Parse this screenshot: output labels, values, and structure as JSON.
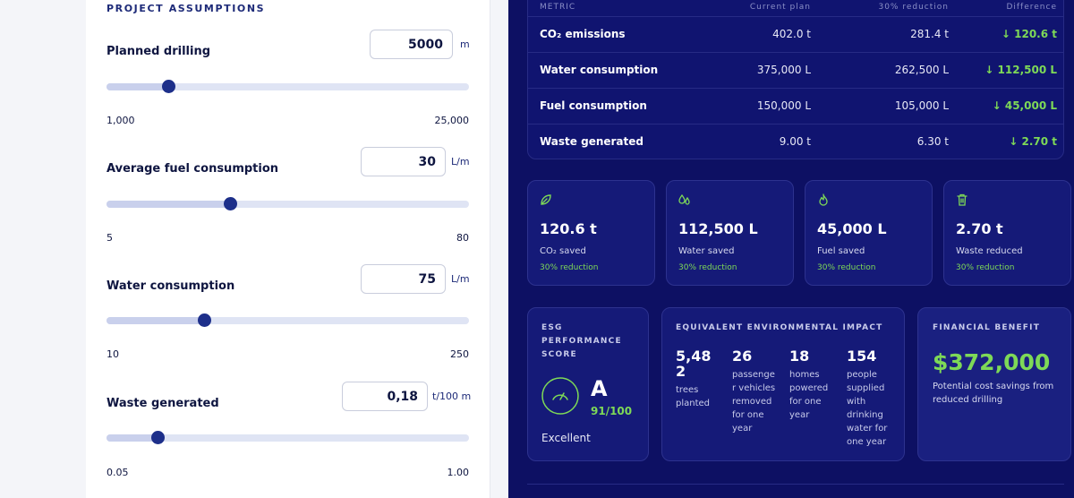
{
  "left": {
    "section_title": "PROJECT ASSUMPTIONS",
    "fields": [
      {
        "label": "Planned drilling",
        "value": "5000",
        "unit": "m",
        "min": "1,000",
        "max": "25,000",
        "slider_fraction": 0.17
      },
      {
        "label": "Average fuel consumption",
        "value": "30",
        "unit": "L/m",
        "min": "5",
        "max": "80",
        "slider_fraction": 0.34
      },
      {
        "label": "Water consumption",
        "value": "75",
        "unit": "L/m",
        "min": "10",
        "max": "250",
        "slider_fraction": 0.27
      },
      {
        "label": "Waste generated",
        "value": "0,18",
        "unit": "t/100 m",
        "min": "0.05",
        "max": "1.00",
        "slider_fraction": 0.14
      }
    ]
  },
  "table": {
    "headers": [
      "METRIC",
      "Current plan",
      "30% reduction",
      "Difference"
    ],
    "rows": [
      {
        "metric": "CO₂ emissions",
        "current": "402.0 t",
        "reduced": "281.4 t",
        "diff": "↓ 120.6 t"
      },
      {
        "metric": "Water consumption",
        "current": "375,000 L",
        "reduced": "262,500 L",
        "diff": "↓ 112,500 L"
      },
      {
        "metric": "Fuel consumption",
        "current": "150,000 L",
        "reduced": "105,000 L",
        "diff": "↓ 45,000 L"
      },
      {
        "metric": "Waste generated",
        "current": "9.00 t",
        "reduced": "6.30 t",
        "diff": "↓ 2.70 t"
      }
    ]
  },
  "cards": [
    {
      "icon": "leaf-icon",
      "value": "120.6 t",
      "label": "CO₂ saved",
      "sub": "30% reduction"
    },
    {
      "icon": "water-drops-icon",
      "value": "112,500 L",
      "label": "Water saved",
      "sub": "30% reduction"
    },
    {
      "icon": "flame-icon",
      "value": "45,000 L",
      "label": "Fuel saved",
      "sub": "30% reduction"
    },
    {
      "icon": "trash-icon",
      "value": "2.70 t",
      "label": "Waste reduced",
      "sub": "30% reduction"
    }
  ],
  "esg": {
    "title_lines": [
      "ESG",
      "PERFORMANCE",
      "SCORE"
    ],
    "grade": "A",
    "score": "91/100",
    "rating": "Excellent"
  },
  "impact": {
    "title": "EQUIVALENT ENVIRONMENTAL IMPACT",
    "items": [
      {
        "value_lines": [
          "5,48",
          "2"
        ],
        "label_lines": [
          "trees",
          "planted"
        ]
      },
      {
        "value_lines": [
          "26"
        ],
        "label_lines": [
          "passenge",
          "r vehicles",
          "removed",
          "for one",
          "year"
        ]
      },
      {
        "value_lines": [
          "18"
        ],
        "label_lines": [
          "homes",
          "powered",
          "for one",
          "year"
        ]
      },
      {
        "value_lines": [
          "154"
        ],
        "label_lines": [
          "people",
          "supplied",
          "with",
          "drinking",
          "water for",
          "one year"
        ]
      }
    ]
  },
  "financial": {
    "title": "FINANCIAL BENEFIT",
    "value": "$372,000",
    "label": "Potential cost savings from reduced drilling"
  },
  "colors": {
    "navy": "#0d1063",
    "accent_green": "#7ed957",
    "slider_thumb": "#1d2f8a"
  }
}
